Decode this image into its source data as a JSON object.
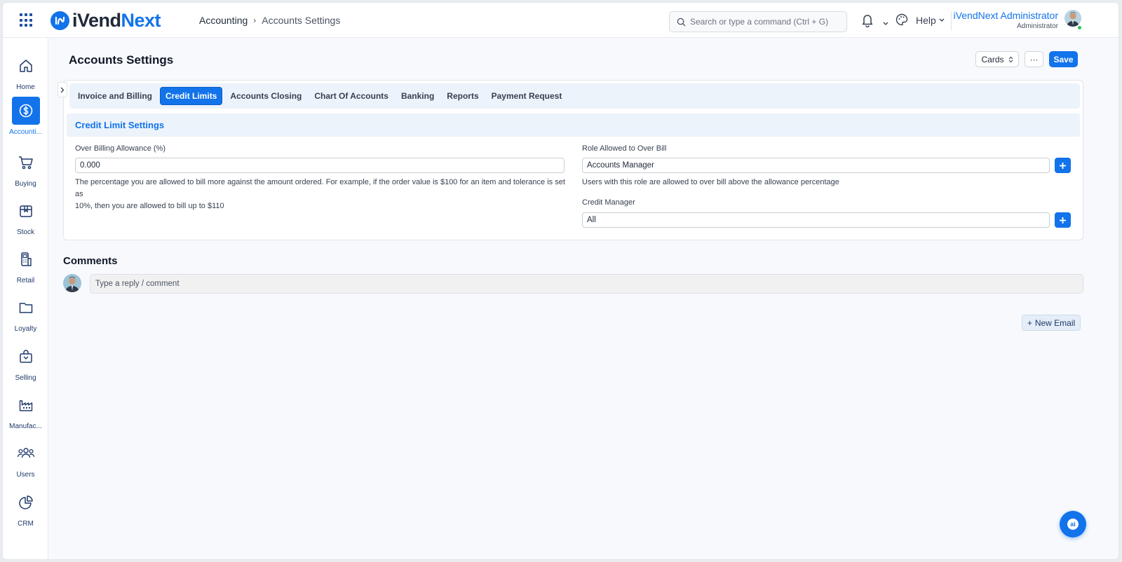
{
  "app": {
    "logo_part1": "iVend",
    "logo_part2": "Next"
  },
  "breadcrumb": {
    "parent": "Accounting",
    "current": "Accounts Settings"
  },
  "search": {
    "placeholder": "Search or type a command (Ctrl + G)"
  },
  "header": {
    "help_label": "Help",
    "user_name": "iVendNext Administrator",
    "user_role": "Administrator"
  },
  "sidebar": {
    "items": [
      {
        "label": "Home",
        "icon": "home-icon"
      },
      {
        "label": "Accounti...",
        "icon": "dollar-icon",
        "active": true
      },
      {
        "label": "Buying",
        "icon": "cart-icon"
      },
      {
        "label": "Stock",
        "icon": "box-icon"
      },
      {
        "label": "Retail",
        "icon": "pos-icon"
      },
      {
        "label": "Loyalty",
        "icon": "folder-icon"
      },
      {
        "label": "Selling",
        "icon": "shopping-bag-icon"
      },
      {
        "label": "Manufac...",
        "icon": "factory-icon"
      },
      {
        "label": "Users",
        "icon": "users-icon"
      },
      {
        "label": "CRM",
        "icon": "pie-chart-icon"
      }
    ]
  },
  "page": {
    "title": "Accounts Settings",
    "cards_label": "Cards",
    "more_label": "···",
    "save_label": "Save"
  },
  "tabs": [
    {
      "label": "Invoice and Billing"
    },
    {
      "label": "Credit Limits",
      "active": true
    },
    {
      "label": "Accounts Closing"
    },
    {
      "label": "Chart Of Accounts"
    },
    {
      "label": "Banking"
    },
    {
      "label": "Reports"
    },
    {
      "label": "Payment Request"
    }
  ],
  "section": {
    "title": "Credit Limit Settings",
    "over_billing": {
      "label": "Over Billing Allowance (%)",
      "value": "0.000",
      "description_line1": "The percentage you are allowed to bill more against the amount ordered. For example, if the order value is $100 for an item and tolerance is set as",
      "description_line2": "10%, then you are allowed to bill up to $110"
    },
    "role_over_bill": {
      "label": "Role Allowed to Over Bill",
      "value": "Accounts Manager",
      "description": "Users with this role are allowed to over bill above the allowance percentage"
    },
    "credit_manager": {
      "label": "Credit Manager",
      "value": "All"
    }
  },
  "comments": {
    "title": "Comments",
    "placeholder": "Type a reply / comment"
  },
  "new_email_label": "New Email",
  "ai_label": "ai",
  "colors": {
    "accent": "#1273eb",
    "online": "#22c55e"
  }
}
